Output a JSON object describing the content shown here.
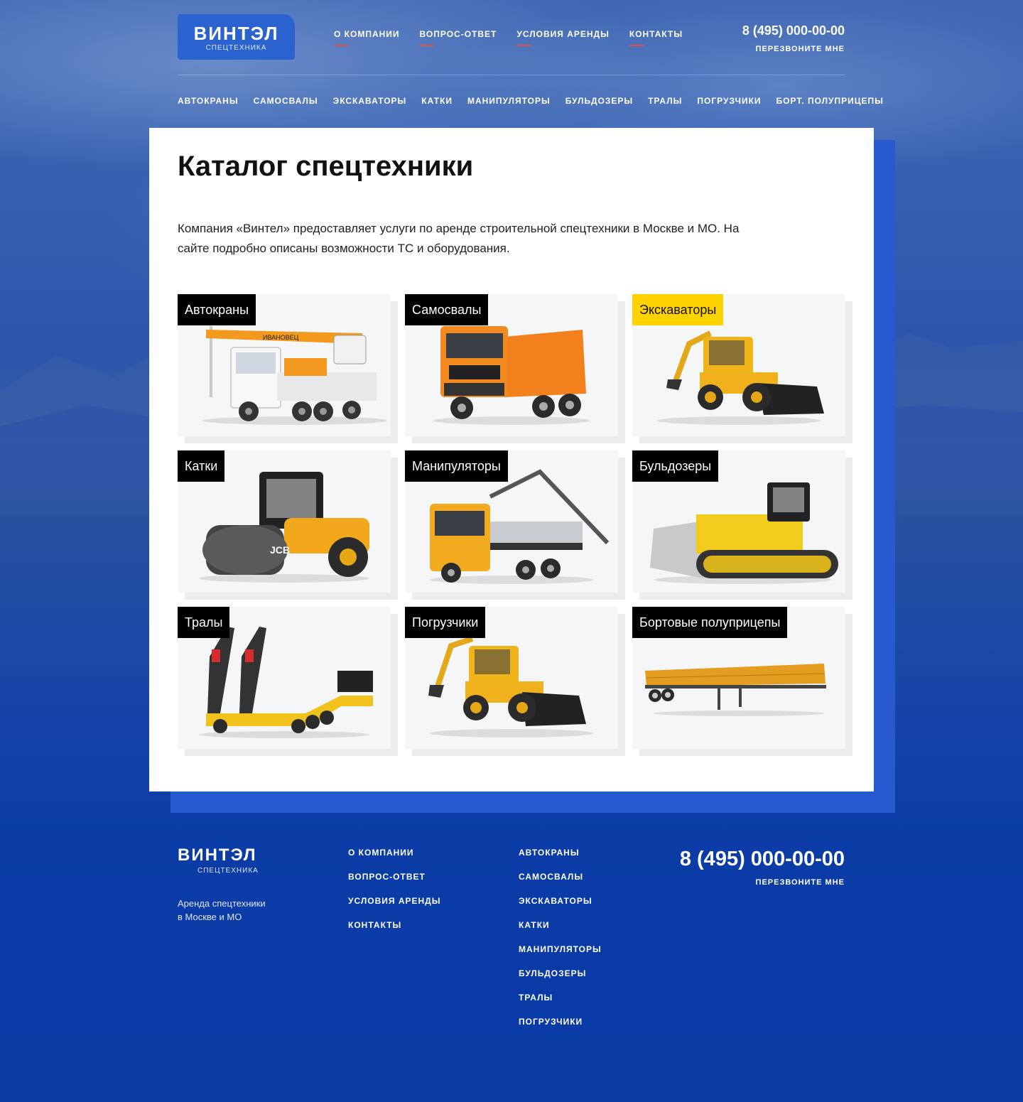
{
  "header": {
    "logo_brand": "ВИНТЭЛ",
    "logo_sub": "СПЕЦТЕХНИКА",
    "nav": [
      "О КОМПАНИИ",
      "ВОПРОС-ОТВЕТ",
      "УСЛОВИЯ АРЕНДЫ",
      "КОНТАКТЫ"
    ],
    "phone": "8 (495) 000-00-00",
    "callback": "ПЕРЕЗВОНИТЕ МНЕ",
    "categories": [
      "АВТОКРАНЫ",
      "САМОСВАЛЫ",
      "ЭКСКАВАТОРЫ",
      "КАТКИ",
      "МАНИПУЛЯТОРЫ",
      "БУЛЬДОЗЕРЫ",
      "ТРАЛЫ",
      "ПОГРУЗЧИКИ",
      "БОРТ. ПОЛУПРИЦЕПЫ"
    ]
  },
  "main": {
    "title": "Каталог спецтехники",
    "intro": "Компания «Винтел» предоставляет услуги по аренде строительной спецтехники в Москве и МО. На сайте подробно описаны возможности ТС и оборудования.",
    "tiles": [
      {
        "label": "Автокраны",
        "icon": "truck-crane-image"
      },
      {
        "label": "Самосвалы",
        "icon": "dump-truck-image"
      },
      {
        "label": "Экскаваторы",
        "icon": "excavator-image",
        "highlight": true
      },
      {
        "label": "Катки",
        "icon": "road-roller-image"
      },
      {
        "label": "Манипуляторы",
        "icon": "manipulator-truck-image"
      },
      {
        "label": "Бульдозеры",
        "icon": "bulldozer-image"
      },
      {
        "label": "Тралы",
        "icon": "lowboy-trailer-image"
      },
      {
        "label": "Погрузчики",
        "icon": "backhoe-loader-image"
      },
      {
        "label": "Бортовые полуприцепы",
        "icon": "flatbed-semitrailer-image"
      }
    ]
  },
  "footer": {
    "logo_brand": "ВИНТЭЛ",
    "logo_sub": "СПЕЦТЕХНИКА",
    "tagline_1": "Аренда спецтехники",
    "tagline_2": "в Москве и МО",
    "col1": [
      "О КОМПАНИИ",
      "ВОПРОС-ОТВЕТ",
      "УСЛОВИЯ АРЕНДЫ",
      "КОНТАКТЫ"
    ],
    "col2": [
      "АВТОКРАНЫ",
      "САМОСВАЛЫ",
      "ЭКСКАВАТОРЫ",
      "КАТКИ",
      "МАНИПУЛЯТОРЫ",
      "БУЛЬДОЗЕРЫ",
      "ТРАЛЫ",
      "ПОГРУЗЧИКИ"
    ],
    "phone": "8 (495) 000-00-00",
    "callback": "ПЕРЕЗВОНИТЕ МНЕ"
  },
  "colors": {
    "accent_blue": "#2a63cf",
    "underline_red": "#e2503b",
    "highlight_yellow": "#ffd300",
    "background_blue": "#0b3aa3"
  }
}
